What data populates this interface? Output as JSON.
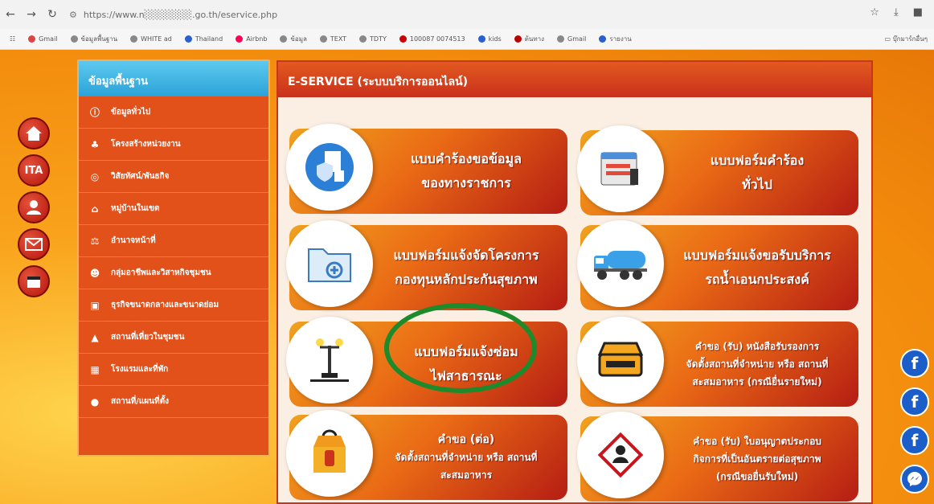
{
  "browser": {
    "url": "https://www.n░░░░░░░.go.th/eservice.php",
    "bookmarks": [
      "Gmail",
      "ข้อมูลพื้นฐาน",
      "WHITE ad",
      "Thailand",
      "Airbnb",
      "ข้อมูล",
      "TEXT",
      "TDTY",
      "100087 0074513",
      "kids",
      "ต้นทาง",
      "Gmail",
      "รายงาน"
    ],
    "bookmarks_folder": "บุ๊กมาร์กอื่นๆ"
  },
  "left_icons": [
    "home-icon",
    "ita-badge",
    "user-icon",
    "mail-icon",
    "calendar-icon"
  ],
  "ita_label": "ITA",
  "sidebar": {
    "title": "ข้อมูลพื้นฐาน",
    "items": [
      {
        "label": "ข้อมูลทั่วไป",
        "icon": "info-icon"
      },
      {
        "label": "โครงสร้างหน่วยงาน",
        "icon": "org-chart-icon"
      },
      {
        "label": "วิสัยทัศน์/พันธกิจ",
        "icon": "target-icon"
      },
      {
        "label": "หมู่บ้านในเขต",
        "icon": "houses-icon"
      },
      {
        "label": "อำนาจหน้าที่",
        "icon": "scale-icon"
      },
      {
        "label": "กลุ่มอาชีพและวิสาหกิจชุมชน",
        "icon": "group-icon"
      },
      {
        "label": "ธุรกิจขนาดกลางและขนาดย่อม",
        "icon": "shop-icon"
      },
      {
        "label": "สถานที่เที่ยวในชุมชน",
        "icon": "mountain-icon"
      },
      {
        "label": "โรงแรมและที่พัก",
        "icon": "hotel-icon"
      },
      {
        "label": "สถานที่/แผนที่ตั้ง",
        "icon": "pin-icon"
      }
    ]
  },
  "main": {
    "title": "E-SERVICE (ระบบบริการออนไลน์)",
    "cards": [
      {
        "lines": [
          "แบบคำร้องขอข้อมูล",
          "ของทางราชการ"
        ],
        "icon": "document-shield-icon"
      },
      {
        "lines": [
          "แบบฟอร์มคำร้อง",
          "ทั่วไป"
        ],
        "icon": "form-icon"
      },
      {
        "lines": [
          "แบบฟอร์มแจ้งจัดโครงการ",
          "กองทุนหลักประกันสุขภาพ"
        ],
        "icon": "folder-plus-icon"
      },
      {
        "lines": [
          "แบบฟอร์มแจ้งขอรับบริการ",
          "รถน้ำเอนกประสงค์"
        ],
        "icon": "water-truck-icon"
      },
      {
        "lines": [
          "แบบฟอร์มแจ้งซ่อม",
          "ไฟสาธารณะ"
        ],
        "icon": "street-light-icon"
      },
      {
        "lines": [
          "คำขอ (รับ) หนังสือรับรองการ",
          "จัดตั้งสถานที่จำหน่าย หรือ สถานที่",
          "สะสมอาหาร (กรณียื่นรายใหม่)"
        ],
        "icon": "food-box-icon"
      },
      {
        "lines": [
          "คำขอ (ต่อ)",
          "จัดตั้งสถานที่จำหน่าย หรือ สถานที่",
          "สะสมอาหาร"
        ],
        "icon": "takeaway-box-icon"
      },
      {
        "lines": [
          "คำขอ (รับ) ใบอนุญาตประกอบ",
          "กิจการที่เป็นอันตรายต่อสุขภาพ",
          "(กรณีขอยื่นรับใหม่)"
        ],
        "icon": "hazard-icon"
      }
    ]
  },
  "social": [
    "facebook-icon",
    "facebook-icon",
    "facebook-icon",
    "messenger-icon"
  ],
  "colors": {
    "accent": "#e2511a",
    "header_blue": "#2aa3d8",
    "highlight_ring": "#1d8a2b",
    "facebook": "#1b5ec9"
  }
}
